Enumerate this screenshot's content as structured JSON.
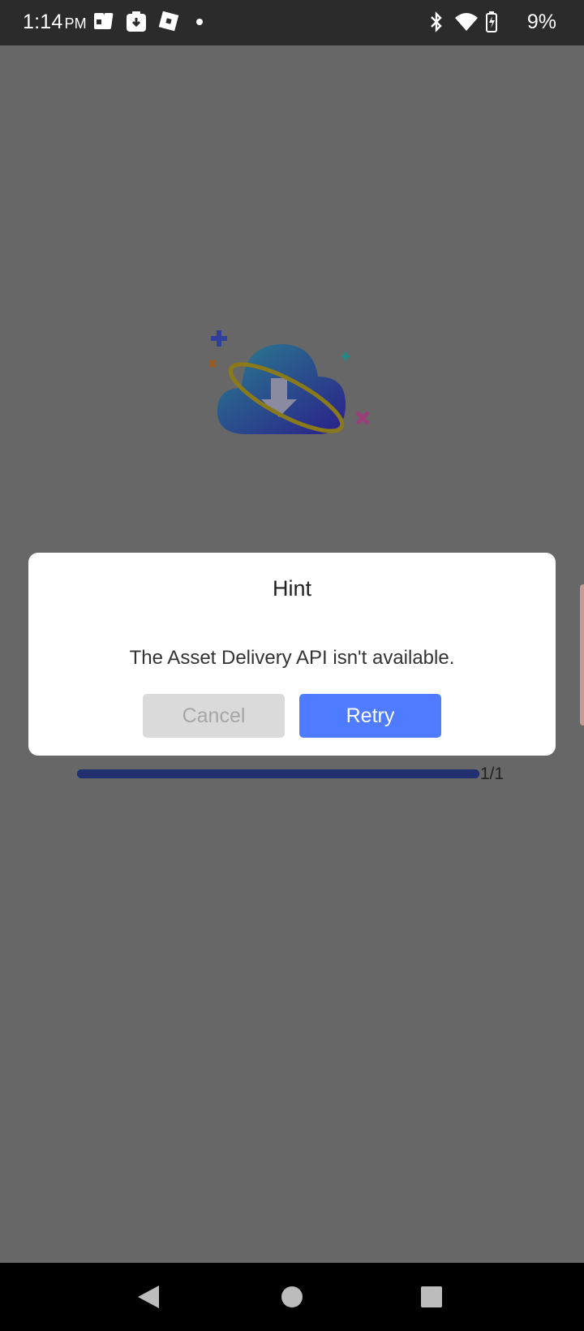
{
  "status_bar": {
    "time": "1:14",
    "ampm": "PM",
    "left_icons": [
      "sim-cards-icon",
      "download-badge-icon",
      "roblox-icon",
      "dot-icon"
    ],
    "right_icons": [
      "bluetooth-icon",
      "wifi-icon",
      "battery-charging-icon"
    ],
    "battery_percent": "9%"
  },
  "loader": {
    "illustration": "cloud-download-icon",
    "progress": {
      "fraction": 1.0,
      "count_label": "1/1"
    }
  },
  "dialog": {
    "title": "Hint",
    "message": "The Asset Delivery API isn't available.",
    "cancel_label": "Cancel",
    "retry_label": "Retry"
  },
  "nav_bar": {
    "buttons": [
      "back-icon",
      "home-icon",
      "recents-icon"
    ]
  },
  "colors": {
    "overlay_background": "#676767",
    "primary_button": "#4e7bff",
    "progress_bar": "#223070"
  }
}
